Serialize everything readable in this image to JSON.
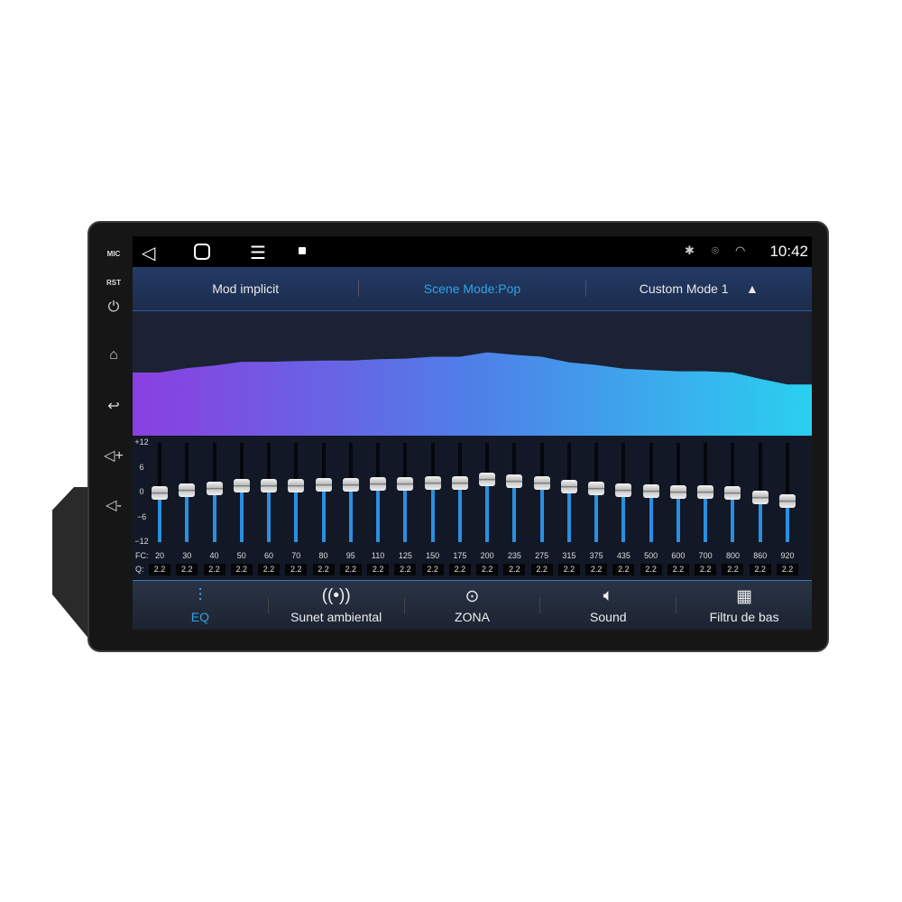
{
  "device": {
    "side_labels": [
      "MIC",
      "RST"
    ]
  },
  "status_bar": {
    "time": "10:42",
    "icons": [
      "back-icon",
      "home-icon",
      "menu-icon",
      "gallery-icon",
      "bluetooth-icon",
      "location-icon",
      "wifi-icon"
    ]
  },
  "header": {
    "items": [
      "Mod implicit",
      "Scene Mode:Pop",
      "Custom Mode 1"
    ],
    "active": 1
  },
  "eq": {
    "y_ticks": [
      "+12",
      "6",
      "0",
      "−6",
      "−12"
    ],
    "fc_label": "FC:",
    "q_label": "Q:",
    "range_db": [
      -12,
      12
    ],
    "bands": [
      {
        "fc": "20",
        "q": "2.2",
        "gain": 0
      },
      {
        "fc": "30",
        "q": "2.2",
        "gain": 0.7
      },
      {
        "fc": "40",
        "q": "2.2",
        "gain": 1.1
      },
      {
        "fc": "50",
        "q": "2.2",
        "gain": 1.7
      },
      {
        "fc": "60",
        "q": "2.2",
        "gain": 1.7
      },
      {
        "fc": "70",
        "q": "2.2",
        "gain": 1.8
      },
      {
        "fc": "80",
        "q": "2.2",
        "gain": 1.9
      },
      {
        "fc": "95",
        "q": "2.2",
        "gain": 1.9
      },
      {
        "fc": "110",
        "q": "2.2",
        "gain": 2.1
      },
      {
        "fc": "125",
        "q": "2.2",
        "gain": 2.2
      },
      {
        "fc": "150",
        "q": "2.2",
        "gain": 2.5
      },
      {
        "fc": "175",
        "q": "2.2",
        "gain": 2.5
      },
      {
        "fc": "200",
        "q": "2.2",
        "gain": 3.2
      },
      {
        "fc": "235",
        "q": "2.2",
        "gain": 2.8
      },
      {
        "fc": "275",
        "q": "2.2",
        "gain": 2.5
      },
      {
        "fc": "315",
        "q": "2.2",
        "gain": 1.6
      },
      {
        "fc": "375",
        "q": "2.2",
        "gain": 1.2
      },
      {
        "fc": "435",
        "q": "2.2",
        "gain": 0.6
      },
      {
        "fc": "500",
        "q": "2.2",
        "gain": 0.4
      },
      {
        "fc": "600",
        "q": "2.2",
        "gain": 0.2
      },
      {
        "fc": "700",
        "q": "2.2",
        "gain": 0.2
      },
      {
        "fc": "800",
        "q": "2.2",
        "gain": 0
      },
      {
        "fc": "860",
        "q": "2.2",
        "gain": -1
      },
      {
        "fc": "920",
        "q": "2.2",
        "gain": -1.9
      }
    ]
  },
  "colors": {
    "accent": "#2fa4e7",
    "curve_start": "#8a3fe0",
    "curve_end": "#2ad0f0",
    "slider_fill": "#2b8fe0"
  },
  "tabs": [
    {
      "label": "EQ",
      "icon": "eq-sliders-icon"
    },
    {
      "label": "Sunet ambiental",
      "icon": "surround-icon"
    },
    {
      "label": "ZONA",
      "icon": "zone-target-icon"
    },
    {
      "label": "Sound",
      "icon": "speaker-icon"
    },
    {
      "label": "Filtru de bas",
      "icon": "bass-filter-icon"
    }
  ],
  "active_tab": 0
}
